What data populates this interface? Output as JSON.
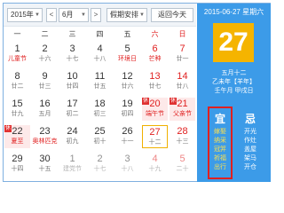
{
  "toolbar": {
    "year": "2015年",
    "prev": "<",
    "month": "6月",
    "next": ">",
    "holiday": "假期安排",
    "today_btn": "返回今天"
  },
  "weekdays": [
    "一",
    "二",
    "三",
    "四",
    "五",
    "六",
    "日"
  ],
  "days": [
    {
      "d": "1",
      "l": "儿童节",
      "fest": true
    },
    {
      "d": "2",
      "l": "十六"
    },
    {
      "d": "3",
      "l": "十七"
    },
    {
      "d": "4",
      "l": "十八"
    },
    {
      "d": "5",
      "l": "环境日",
      "fest": true
    },
    {
      "d": "6",
      "l": "芒种",
      "fest": true,
      "we": true
    },
    {
      "d": "7",
      "l": "廿一",
      "we": true
    },
    {
      "d": "8",
      "l": "廿二"
    },
    {
      "d": "9",
      "l": "廿三"
    },
    {
      "d": "10",
      "l": "廿四"
    },
    {
      "d": "11",
      "l": "廿五"
    },
    {
      "d": "12",
      "l": "廿六"
    },
    {
      "d": "13",
      "l": "廿七",
      "we": true
    },
    {
      "d": "14",
      "l": "廿八",
      "we": true
    },
    {
      "d": "15",
      "l": "廿九"
    },
    {
      "d": "16",
      "l": "五月"
    },
    {
      "d": "17",
      "l": "初二"
    },
    {
      "d": "18",
      "l": "初三"
    },
    {
      "d": "19",
      "l": "初四"
    },
    {
      "d": "20",
      "l": "端午节",
      "fest": true,
      "we": true,
      "hol": true,
      "tag": "休",
      "tagType": "xiu"
    },
    {
      "d": "21",
      "l": "父亲节",
      "fest": true,
      "we": true,
      "hol": true,
      "tag": "休",
      "tagType": "xiu"
    },
    {
      "d": "22",
      "l": "夏至",
      "fest": true,
      "hol": true,
      "tag": "休",
      "tagType": "xiu"
    },
    {
      "d": "23",
      "l": "奥林匹克",
      "fest": true
    },
    {
      "d": "24",
      "l": "初九"
    },
    {
      "d": "25",
      "l": "初十"
    },
    {
      "d": "26",
      "l": "十一"
    },
    {
      "d": "27",
      "l": "十二",
      "we": true,
      "today": true
    },
    {
      "d": "28",
      "l": "十三",
      "we": true
    },
    {
      "d": "29",
      "l": "十四"
    },
    {
      "d": "30",
      "l": "十五"
    },
    {
      "d": "1",
      "l": "建党节",
      "muted": true
    },
    {
      "d": "2",
      "l": "十七",
      "muted": true
    },
    {
      "d": "3",
      "l": "十八",
      "muted": true
    },
    {
      "d": "4",
      "l": "十九",
      "muted": true,
      "we": true
    },
    {
      "d": "5",
      "l": "二十",
      "muted": true,
      "we": true
    }
  ],
  "side": {
    "date_line": "2015-06-27 星期六",
    "big_day": "27",
    "lunar1": "五月十二",
    "lunar2": "乙未年【羊年】",
    "lunar3": "壬午月 甲戌日",
    "yi_title": "宜",
    "yi_items": [
      "嫁娶",
      "纳采",
      "冠笄",
      "祈福",
      "出行"
    ],
    "ji_title": "忌",
    "ji_items": [
      "开光",
      "作灶",
      "盖屋",
      "架马",
      "开仓"
    ]
  },
  "colors": {
    "accent": "#3c9be8",
    "today_bg": "#f5b400",
    "weekend": "#e02020",
    "yi_border": "#e02020"
  }
}
